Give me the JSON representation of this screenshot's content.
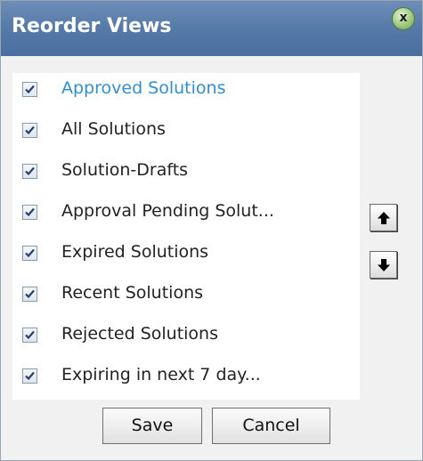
{
  "dialog": {
    "title": "Reorder Views",
    "close_label": "x",
    "close_icon": "close-icon"
  },
  "views": [
    {
      "label": "Approved Solutions",
      "checked": true,
      "selected": true
    },
    {
      "label": "All Solutions",
      "checked": true,
      "selected": false
    },
    {
      "label": "Solution-Drafts",
      "checked": true,
      "selected": false
    },
    {
      "label": "Approval Pending Solut...",
      "checked": true,
      "selected": false
    },
    {
      "label": "Expired Solutions",
      "checked": true,
      "selected": false
    },
    {
      "label": "Recent Solutions",
      "checked": true,
      "selected": false
    },
    {
      "label": "Rejected Solutions",
      "checked": true,
      "selected": false
    },
    {
      "label": "Expiring in next 7 day...",
      "checked": true,
      "selected": false
    }
  ],
  "controls": {
    "move_up_icon": "arrow-up-icon",
    "move_down_icon": "arrow-down-icon"
  },
  "footer": {
    "save_label": "Save",
    "cancel_label": "Cancel"
  },
  "colors": {
    "titlebar": "#557aa8",
    "selected_text": "#2f8fd4",
    "panel": "#ffffff",
    "background": "#f1f1f1"
  }
}
